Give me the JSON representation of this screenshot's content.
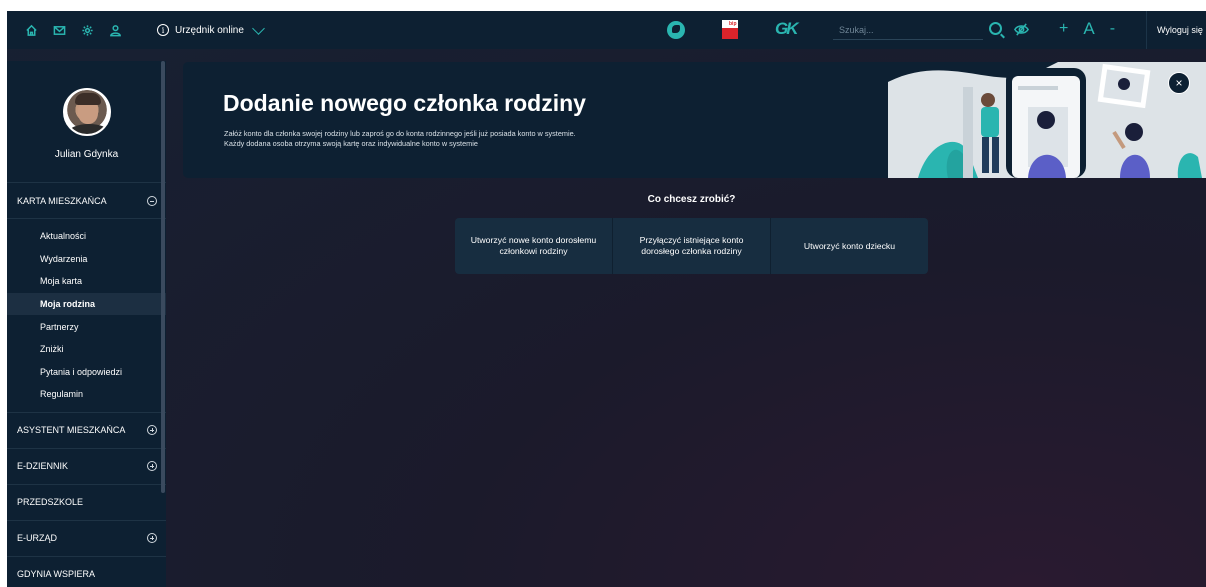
{
  "topbar": {
    "icons": [
      "home-icon",
      "mail-icon",
      "settings-icon",
      "user-icon"
    ],
    "clerk_label": "Urzędnik online",
    "search_placeholder": "Szukaj...",
    "tools": {
      "plus": "+",
      "font": "A",
      "minus": "-"
    },
    "logout_label": "Wyloguj się"
  },
  "profile": {
    "name": "Julian Gdynka"
  },
  "sidebar": {
    "sections": [
      {
        "label": "KARTA MIESZKAŃCA",
        "state": "expanded"
      },
      {
        "label": "ASYSTENT MIESZKAŃCA",
        "state": "collapsed"
      },
      {
        "label": "E-DZIENNIK",
        "state": "collapsed"
      },
      {
        "label": "PRZEDSZKOLE",
        "state": "none"
      },
      {
        "label": "E-URZĄD",
        "state": "collapsed"
      },
      {
        "label": "GDYNIA WSPIERA",
        "state": "none"
      }
    ],
    "submenu": [
      {
        "label": "Aktualności"
      },
      {
        "label": "Wydarzenia"
      },
      {
        "label": "Moja karta"
      },
      {
        "label": "Moja rodzina",
        "active": true
      },
      {
        "label": "Partnerzy"
      },
      {
        "label": "Zniżki"
      },
      {
        "label": "Pytania i odpowiedzi"
      },
      {
        "label": "Regulamin"
      }
    ]
  },
  "banner": {
    "title": "Dodanie nowego członka rodziny",
    "desc_line1": "Załóż konto dla członka swojej rodziny lub zaproś go do konta rodzinnego jeśli już posiada konto w systemie.",
    "desc_line2": "Każdy dodana osoba otrzyma swoją kartę oraz indywidualne konto w systemie",
    "close": "×"
  },
  "main": {
    "question": "Co chcesz zrobić?",
    "choices": [
      "Utworzyć nowe konto dorosłemu członkowi rodziny",
      "Przyłączyć istniejące konto dorosłego członka rodziny",
      "Utworzyć konto dziecku"
    ]
  },
  "colors": {
    "accent": "#2ab5b0",
    "panel": "#0d2032",
    "bg": "#1b1a2b"
  }
}
